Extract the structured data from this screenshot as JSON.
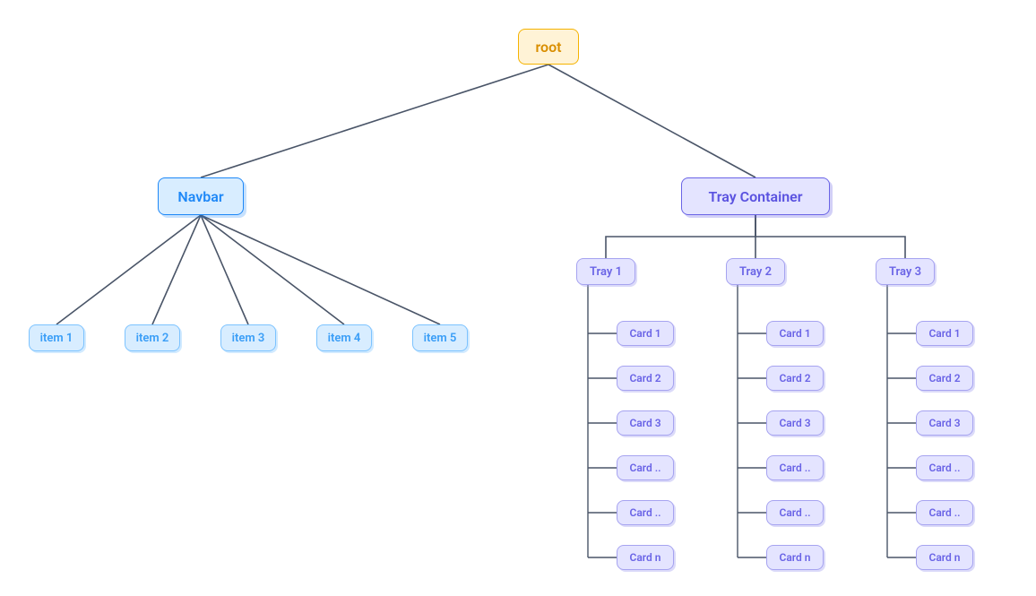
{
  "colors": {
    "root_bg": "#fff3d6",
    "root_border": "#f5b301",
    "root_text": "#d98e00",
    "navbar_bg": "#d8edff",
    "navbar_border": "#1e88f7",
    "navbar_text": "#1e88f7",
    "nav_item_border": "#7cc3ff",
    "tray_bg": "#e4e4ff",
    "tray_border_strong": "#6a64e6",
    "tray_border_light": "#a6a3f0",
    "tray_text": "#5a52e0",
    "edge": "#4a5568"
  },
  "root": {
    "label": "root"
  },
  "navbar": {
    "label": "Navbar",
    "items": [
      {
        "label": "item 1"
      },
      {
        "label": "item 2"
      },
      {
        "label": "item 3"
      },
      {
        "label": "item 4"
      },
      {
        "label": "item 5"
      }
    ]
  },
  "tray_container": {
    "label": "Tray Container",
    "trays": [
      {
        "label": "Tray 1",
        "cards": [
          {
            "label": "Card 1"
          },
          {
            "label": "Card 2"
          },
          {
            "label": "Card 3"
          },
          {
            "label": "Card .."
          },
          {
            "label": "Card .."
          },
          {
            "label": "Card n"
          }
        ]
      },
      {
        "label": "Tray 2",
        "cards": [
          {
            "label": "Card 1"
          },
          {
            "label": "Card 2"
          },
          {
            "label": "Card 3"
          },
          {
            "label": "Card .."
          },
          {
            "label": "Card .."
          },
          {
            "label": "Card n"
          }
        ]
      },
      {
        "label": "Tray 3",
        "cards": [
          {
            "label": "Card 1"
          },
          {
            "label": "Card 2"
          },
          {
            "label": "Card 3"
          },
          {
            "label": "Card .."
          },
          {
            "label": "Card .."
          },
          {
            "label": "Card n"
          }
        ]
      }
    ]
  }
}
